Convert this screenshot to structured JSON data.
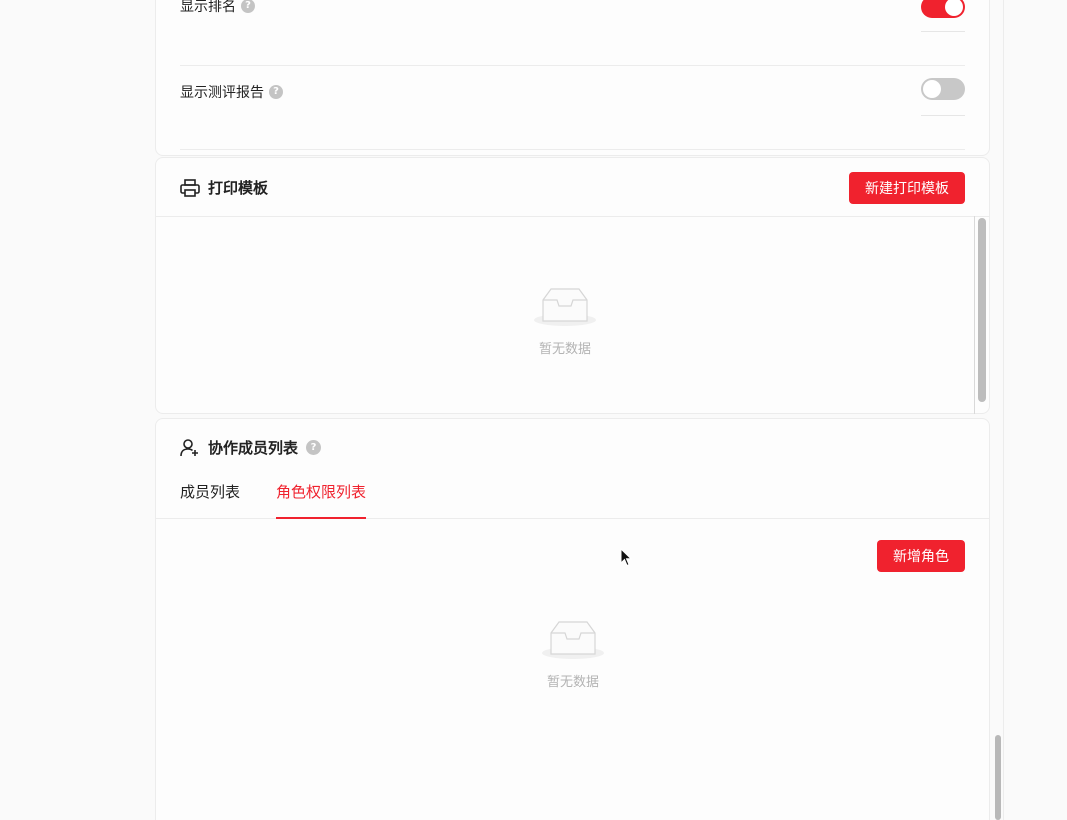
{
  "settings": {
    "rows": [
      {
        "label": "显示排名",
        "enabled": true
      },
      {
        "label": "显示测评报告",
        "enabled": false
      }
    ]
  },
  "print_template": {
    "title": "打印模板",
    "new_button": "新建打印模板",
    "empty_text": "暂无数据",
    "icon": "printer-icon"
  },
  "collaborators": {
    "title": "协作成员列表",
    "icon": "team-icon",
    "tabs": [
      {
        "label": "成员列表",
        "active": false
      },
      {
        "label": "角色权限列表",
        "active": true
      }
    ],
    "add_role_button": "新增角色",
    "empty_text": "暂无数据"
  },
  "colors": {
    "accent": "#f0222e",
    "muted_text": "#b3b3b3",
    "border": "#ececec"
  }
}
